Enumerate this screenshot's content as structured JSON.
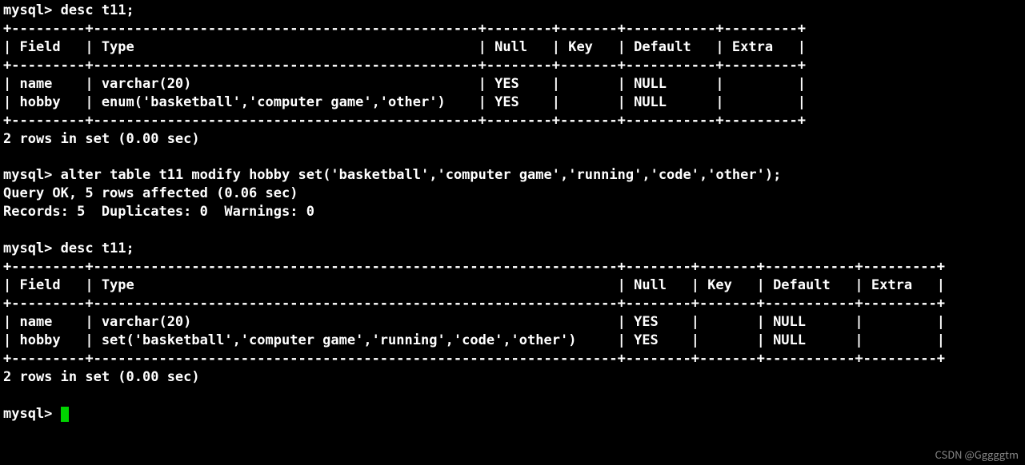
{
  "prompt": "mysql>",
  "commands": {
    "desc1": "desc t11;",
    "alter": "alter table t11 modify hobby set('basketball','computer game','running','code','other');",
    "desc2": "desc t11;"
  },
  "table1": {
    "headers": {
      "field": "Field",
      "type": "Type",
      "null": "Null",
      "key": "Key",
      "default": "Default",
      "extra": "Extra"
    },
    "rows": [
      {
        "field": "name",
        "type": "varchar(20)",
        "null": "YES",
        "key": "",
        "default": "NULL",
        "extra": ""
      },
      {
        "field": "hobby",
        "type": "enum('basketball','computer game','other')",
        "null": "YES",
        "key": "",
        "default": "NULL",
        "extra": ""
      }
    ],
    "footer": "2 rows in set (0.00 sec)"
  },
  "alter_result": {
    "line1": "Query OK, 5 rows affected (0.06 sec)",
    "line2": "Records: 5  Duplicates: 0  Warnings: 0"
  },
  "table2": {
    "headers": {
      "field": "Field",
      "type": "Type",
      "null": "Null",
      "key": "Key",
      "default": "Default",
      "extra": "Extra"
    },
    "rows": [
      {
        "field": "name",
        "type": "varchar(20)",
        "null": "YES",
        "key": "",
        "default": "NULL",
        "extra": ""
      },
      {
        "field": "hobby",
        "type": "set('basketball','computer game','running','code','other')",
        "null": "YES",
        "key": "",
        "default": "NULL",
        "extra": ""
      }
    ],
    "footer": "2 rows in set (0.00 sec)"
  },
  "watermark": "CSDN @Gggggtm",
  "widths": {
    "t1": {
      "field": 7,
      "type": 45,
      "null": 6,
      "key": 5,
      "default": 9,
      "extra": 7
    },
    "t2": {
      "field": 7,
      "type": 62,
      "null": 6,
      "key": 5,
      "default": 9,
      "extra": 7
    }
  }
}
